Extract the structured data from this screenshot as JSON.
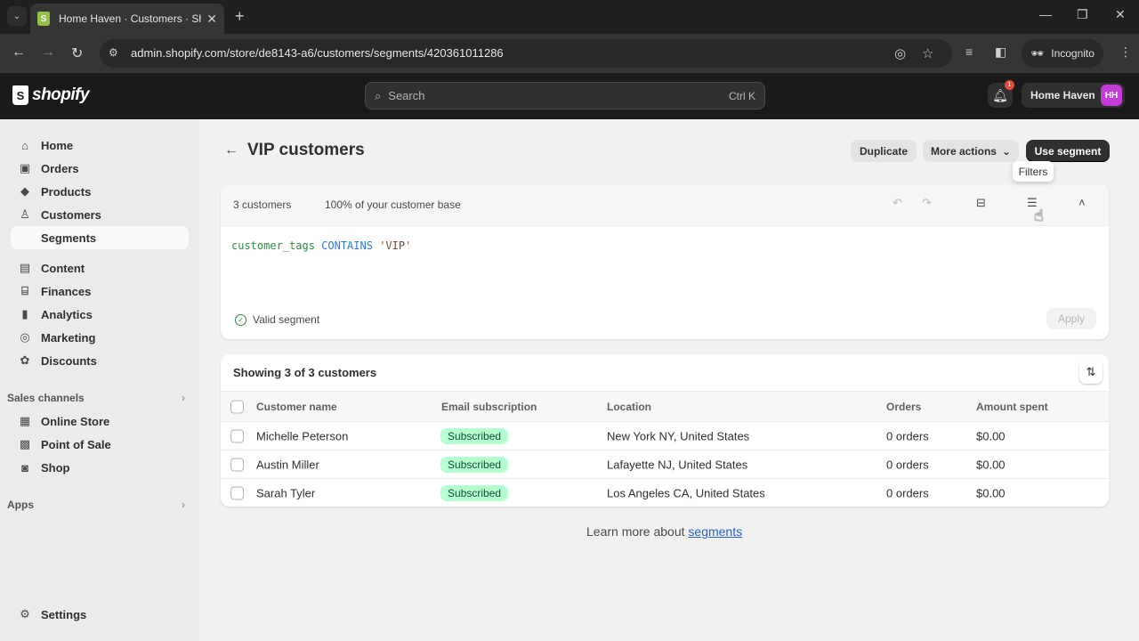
{
  "browser": {
    "tab_title": "Home Haven · Customers · Shopify",
    "url": "admin.shopify.com/store/de8143-a6/customers/segments/420361011286",
    "profile_label": "Incognito"
  },
  "topbar": {
    "logo_text": "shopify",
    "search_placeholder": "Search",
    "search_shortcut": "Ctrl K",
    "notification_count": "1",
    "store_name": "Home Haven",
    "avatar_initials": "HH"
  },
  "sidebar": {
    "items": [
      {
        "label": "Home",
        "icon": "home-icon"
      },
      {
        "label": "Orders",
        "icon": "inbox-icon"
      },
      {
        "label": "Products",
        "icon": "tag-icon"
      },
      {
        "label": "Customers",
        "icon": "person-icon"
      },
      {
        "label": "Segments",
        "icon": "",
        "active": true
      },
      {
        "label": "Content",
        "icon": "image-icon"
      },
      {
        "label": "Finances",
        "icon": "bank-icon"
      },
      {
        "label": "Analytics",
        "icon": "bar-chart-icon"
      },
      {
        "label": "Marketing",
        "icon": "target-icon"
      },
      {
        "label": "Discounts",
        "icon": "discount-icon"
      }
    ],
    "sales_channels_label": "Sales channels",
    "channels": [
      {
        "label": "Online Store",
        "icon": "store-icon"
      },
      {
        "label": "Point of Sale",
        "icon": "pos-icon"
      },
      {
        "label": "Shop",
        "icon": "shop-icon"
      }
    ],
    "apps_label": "Apps",
    "settings_label": "Settings"
  },
  "page": {
    "title": "VIP customers",
    "actions": {
      "duplicate": "Duplicate",
      "more_actions": "More actions",
      "use_segment": "Use segment"
    },
    "tooltip": "Filters"
  },
  "editor": {
    "count": "3 customers",
    "percent": "100% of your customer base",
    "query": {
      "field": "customer_tags",
      "operator": "CONTAINS",
      "value": "'VIP'"
    },
    "status": "Valid segment",
    "apply_label": "Apply"
  },
  "table": {
    "showing": "Showing 3 of 3 customers",
    "columns": [
      "Customer name",
      "Email subscription",
      "Location",
      "Orders",
      "Amount spent"
    ],
    "rows": [
      {
        "name": "Michelle Peterson",
        "subscription": "Subscribed",
        "location": "New York NY, United States",
        "orders": "0 orders",
        "amount": "$0.00"
      },
      {
        "name": "Austin Miller",
        "subscription": "Subscribed",
        "location": "Lafayette NJ, United States",
        "orders": "0 orders",
        "amount": "$0.00"
      },
      {
        "name": "Sarah Tyler",
        "subscription": "Subscribed",
        "location": "Los Angeles CA, United States",
        "orders": "0 orders",
        "amount": "$0.00"
      }
    ]
  },
  "footer": {
    "learn_prefix": "Learn more about ",
    "learn_link": "segments"
  }
}
